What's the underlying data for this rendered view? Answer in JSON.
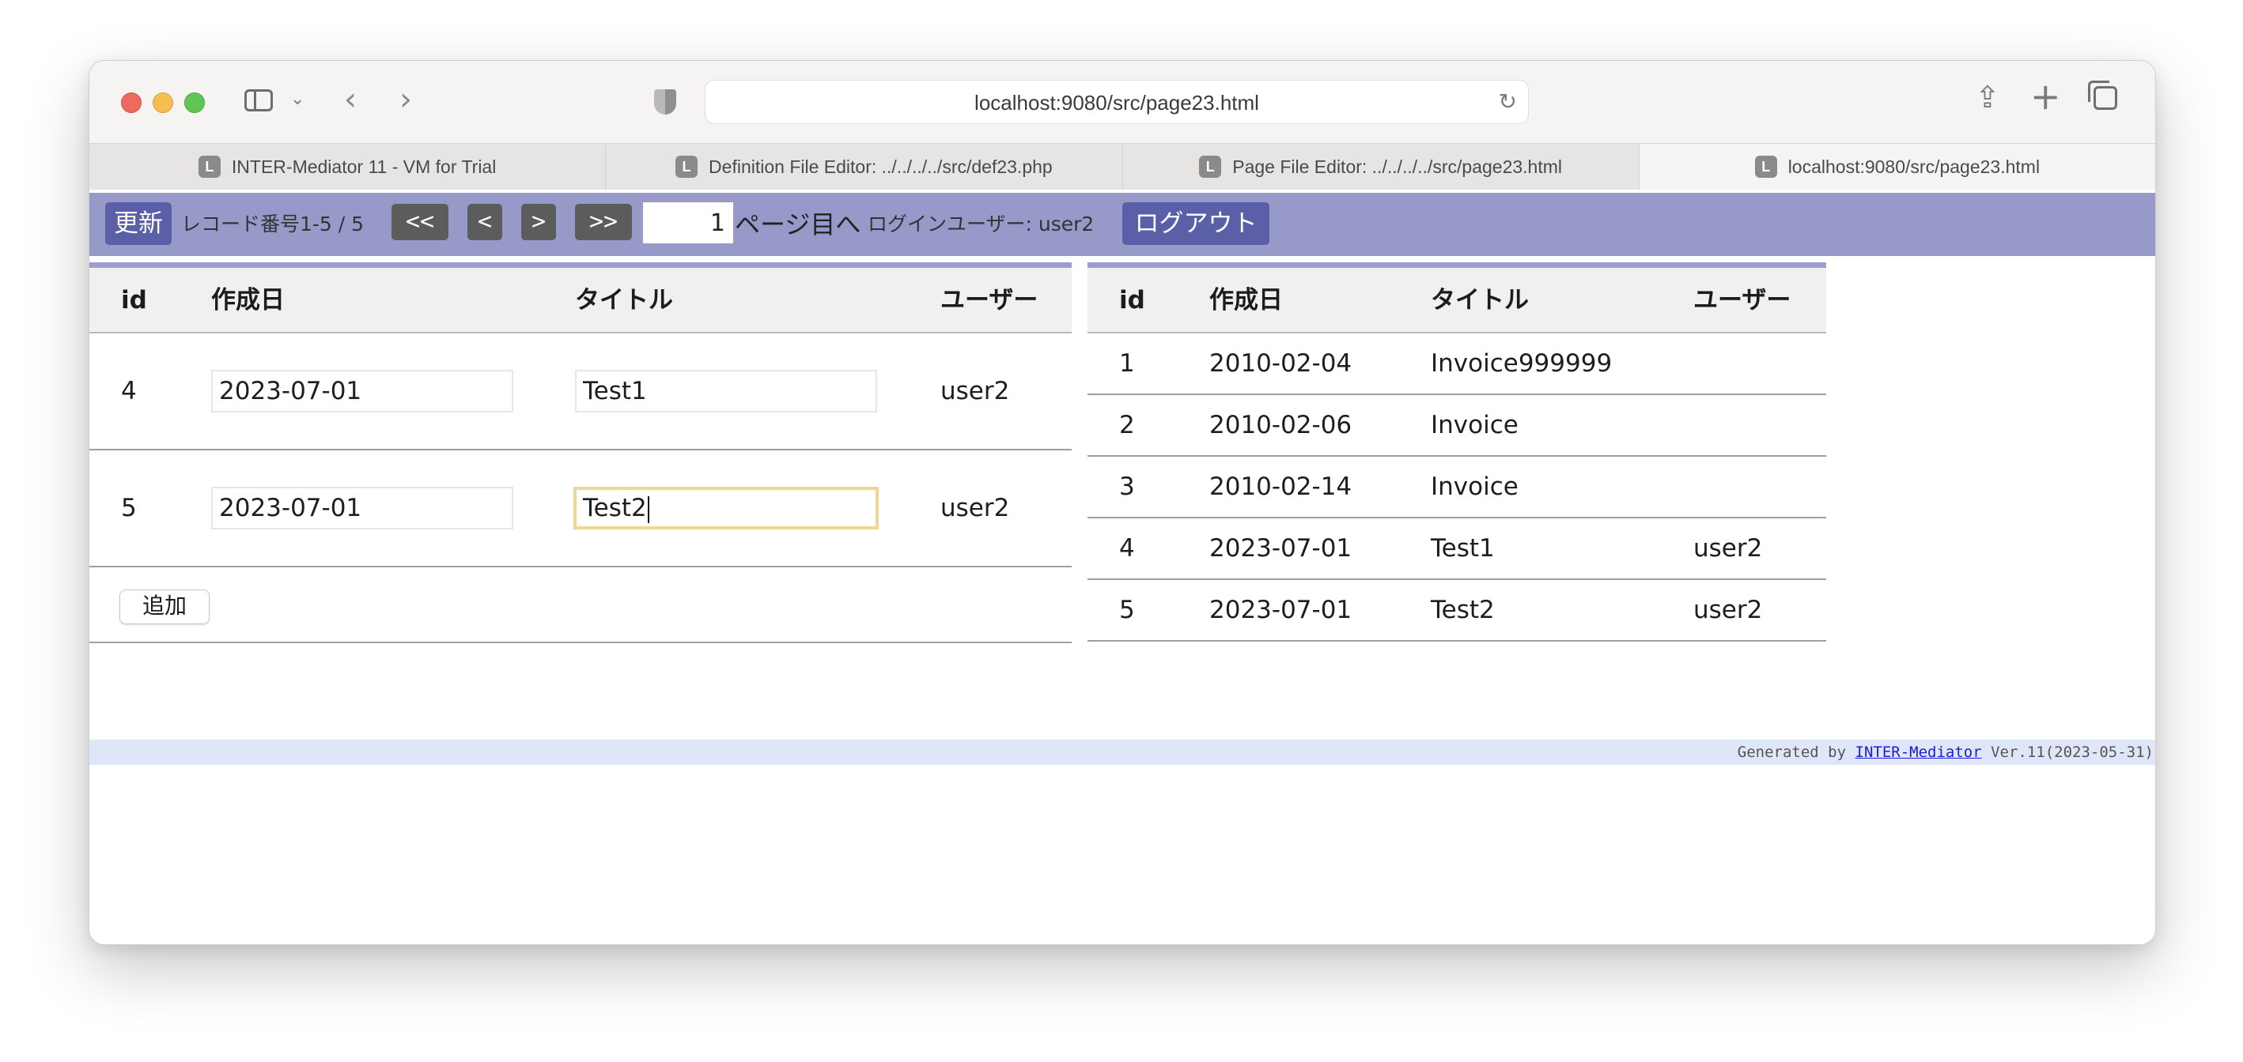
{
  "browser": {
    "url": "localhost:9080/src/page23.html",
    "tabs": [
      {
        "label": "INTER-Mediator 11 - VM for Trial",
        "favicon": "L"
      },
      {
        "label": "Definition File Editor: ../../../../src/def23.php",
        "favicon": "L"
      },
      {
        "label": "Page File Editor: ../../../../src/page23.html",
        "favicon": "L"
      },
      {
        "label": "localhost:9080/src/page23.html",
        "favicon": "L",
        "active": true
      }
    ]
  },
  "navbar": {
    "refresh_label": "更新",
    "record_info": "レコード番号1-5 / 5",
    "first_label": "<<",
    "prev_label": "<",
    "next_label": ">",
    "last_label": ">>",
    "page_value": "1",
    "page_suffix": "ページ目へ",
    "login_user_text": "ログインユーザー: user2",
    "logout_label": "ログアウト",
    "bar_color": "#9799c9",
    "button_color": "#5b5fa8"
  },
  "left_table": {
    "headers": [
      "id",
      "作成日",
      "タイトル",
      "ユーザー"
    ],
    "rows": [
      {
        "id": "4",
        "date": "2023-07-01",
        "title": "Test1",
        "user": "user2"
      },
      {
        "id": "5",
        "date": "2023-07-01",
        "title": "Test2",
        "user": "user2"
      }
    ],
    "add_label": "追加"
  },
  "right_table": {
    "headers": [
      "id",
      "作成日",
      "タイトル",
      "ユーザー"
    ],
    "rows": [
      {
        "id": "1",
        "date": "2010-02-04",
        "title": "Invoice999999",
        "user": ""
      },
      {
        "id": "2",
        "date": "2010-02-06",
        "title": "Invoice",
        "user": ""
      },
      {
        "id": "3",
        "date": "2010-02-14",
        "title": "Invoice",
        "user": ""
      },
      {
        "id": "4",
        "date": "2023-07-01",
        "title": "Test1",
        "user": "user2"
      },
      {
        "id": "5",
        "date": "2023-07-01",
        "title": "Test2",
        "user": "user2"
      }
    ]
  },
  "footer": {
    "prefix": "Generated by ",
    "link": "INTER-Mediator",
    "suffix": " Ver.11(2023-05-31)"
  }
}
